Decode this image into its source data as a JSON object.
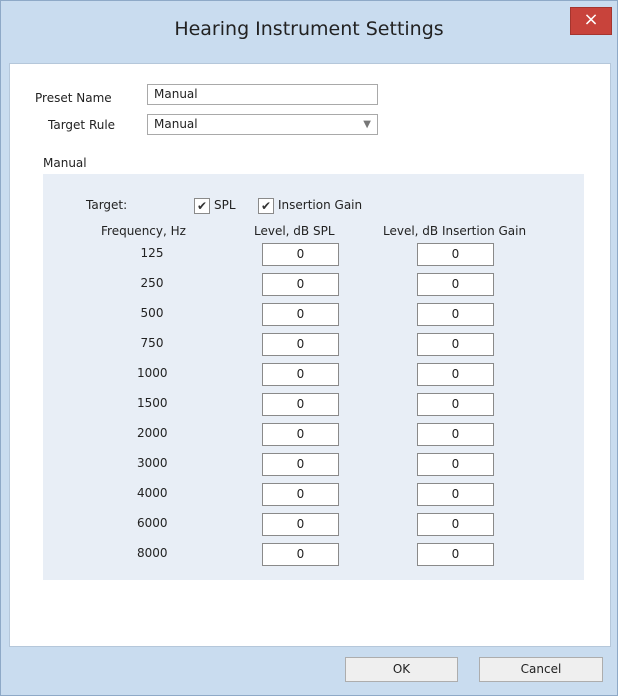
{
  "window": {
    "title": "Hearing Instrument Settings",
    "close_glyph": "×"
  },
  "preset": {
    "name_label": "Preset Name",
    "name_value": "Manual"
  },
  "target_rule": {
    "label": "Target Rule",
    "value": "Manual"
  },
  "group": {
    "label": "Manual"
  },
  "target": {
    "label": "Target:",
    "spl": {
      "label": "SPL",
      "checked": true
    },
    "insertion_gain": {
      "label": "Insertion Gain",
      "checked": true
    }
  },
  "columns": {
    "frequency": "Frequency, Hz",
    "level_spl": "Level, dB SPL",
    "level_ig": "Level, dB Insertion Gain"
  },
  "rows": [
    {
      "freq": "125",
      "spl": "0",
      "ig": "0"
    },
    {
      "freq": "250",
      "spl": "0",
      "ig": "0"
    },
    {
      "freq": "500",
      "spl": "0",
      "ig": "0"
    },
    {
      "freq": "750",
      "spl": "0",
      "ig": "0"
    },
    {
      "freq": "1000",
      "spl": "0",
      "ig": "0"
    },
    {
      "freq": "1500",
      "spl": "0",
      "ig": "0"
    },
    {
      "freq": "2000",
      "spl": "0",
      "ig": "0"
    },
    {
      "freq": "3000",
      "spl": "0",
      "ig": "0"
    },
    {
      "freq": "4000",
      "spl": "0",
      "ig": "0"
    },
    {
      "freq": "6000",
      "spl": "0",
      "ig": "0"
    },
    {
      "freq": "8000",
      "spl": "0",
      "ig": "0"
    }
  ],
  "buttons": {
    "ok": "OK",
    "cancel": "Cancel"
  },
  "icons": {
    "check": "✔",
    "dropdown": "▼"
  },
  "colors": {
    "close_red": "#c8433b",
    "frame": "#c9dcef",
    "group_bg": "#e8eef6"
  }
}
